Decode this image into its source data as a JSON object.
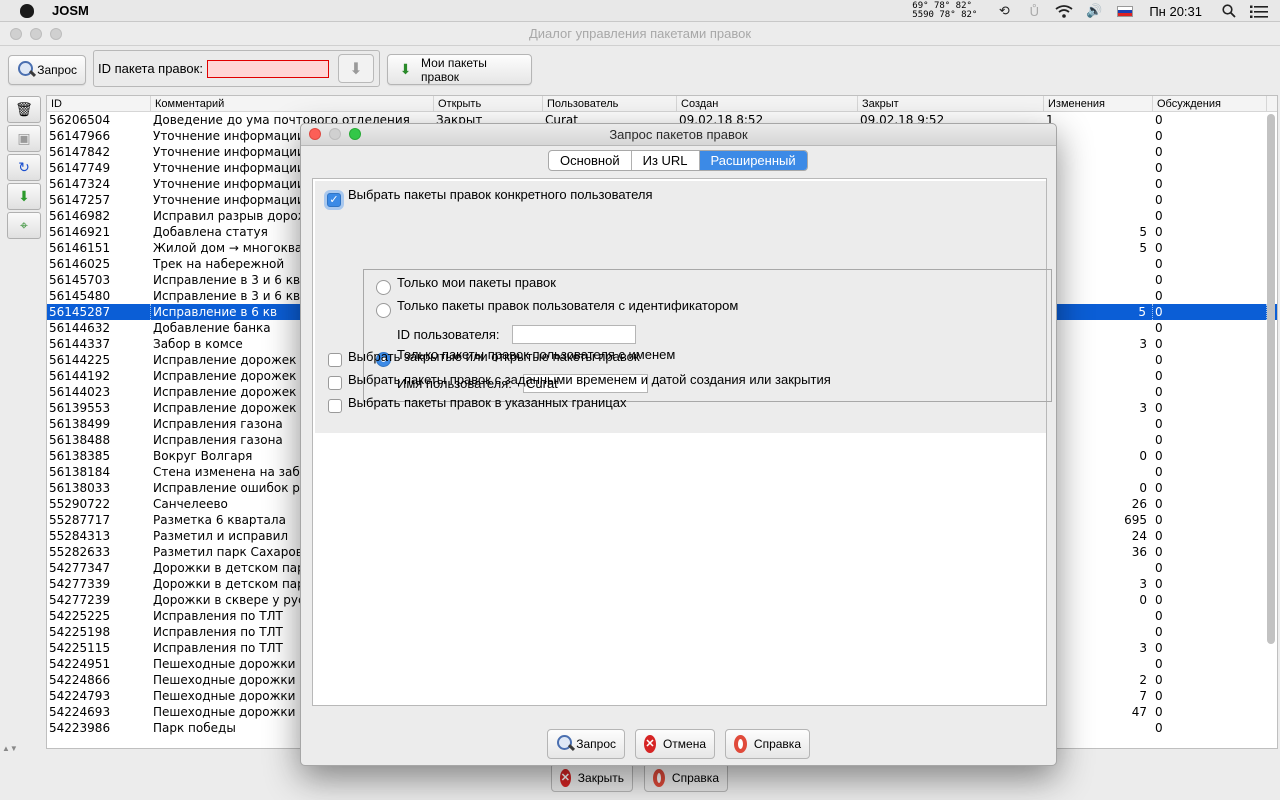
{
  "menubar": {
    "app_name": "JOSM",
    "temps": [
      "69°  78° 82°",
      "5590  78° 82°"
    ],
    "clock": "Пн 20:31",
    "icons": [
      "time-machine-icon",
      "bluetooth-icon",
      "wifi-icon",
      "volume-icon",
      "flag-ru-icon",
      "spotlight-icon",
      "notification-center-icon"
    ]
  },
  "window": {
    "title": "Диалог управления пакетами правок"
  },
  "toolbar": {
    "query_label": "Запрос",
    "changeset_id_label": "ID пакета правок:",
    "changeset_id_value": "",
    "my_changesets_label": "Мои пакеты правок"
  },
  "table": {
    "columns": [
      "ID",
      "Комментарий",
      "Открыть",
      "Пользователь",
      "Создан",
      "Закрыт",
      "Изменения",
      "Обсуждения"
    ],
    "first_row": {
      "id": "56206504",
      "comment": "Доведение до ума почтового отделения",
      "open": "Закрыт",
      "user": "Curat",
      "created": "09.02.18 8:52",
      "closed": "09.02.18 9:52",
      "changes": "1",
      "discussions": "0"
    },
    "rows": [
      {
        "id": "56147966",
        "comment": "Уточнение информации",
        "changes": "",
        "discussions": "0"
      },
      {
        "id": "56147842",
        "comment": "Уточнение информации",
        "changes": "",
        "discussions": "0"
      },
      {
        "id": "56147749",
        "comment": "Уточнение информации",
        "changes": "",
        "discussions": "0"
      },
      {
        "id": "56147324",
        "comment": "Уточнение информации",
        "changes": "",
        "discussions": "0"
      },
      {
        "id": "56147257",
        "comment": "Уточнение информации",
        "changes": "",
        "discussions": "0"
      },
      {
        "id": "56146982",
        "comment": "Исправил разрыв дорож",
        "changes": "",
        "discussions": "0"
      },
      {
        "id": "56146921",
        "comment": "Добавлена статуя",
        "changes": "5",
        "discussions": "0"
      },
      {
        "id": "56146151",
        "comment": "Жилой дом → многоквар",
        "changes": "5",
        "discussions": "0"
      },
      {
        "id": "56146025",
        "comment": "Трек на набережной",
        "changes": "",
        "discussions": "0"
      },
      {
        "id": "56145703",
        "comment": "Исправление в 3 и 6 кв",
        "changes": "",
        "discussions": "0"
      },
      {
        "id": "56145480",
        "comment": "Исправление в 3 и 6 кв",
        "changes": "",
        "discussions": "0"
      },
      {
        "id": "56145287",
        "comment": "Исправление в 6 кв",
        "changes": "5",
        "discussions": "0",
        "selected": true
      },
      {
        "id": "56144632",
        "comment": "Добавление банка",
        "changes": "",
        "discussions": "0"
      },
      {
        "id": "56144337",
        "comment": "Забор в комсе",
        "changes": "3",
        "discussions": "0"
      },
      {
        "id": "56144225",
        "comment": "Исправление дорожек у",
        "changes": "",
        "discussions": "0"
      },
      {
        "id": "56144192",
        "comment": "Исправление дорожек у",
        "changes": "",
        "discussions": "0"
      },
      {
        "id": "56144023",
        "comment": "Исправление дорожек в",
        "changes": "",
        "discussions": "0"
      },
      {
        "id": "56139553",
        "comment": "Исправление дорожек в",
        "changes": "3",
        "discussions": "0"
      },
      {
        "id": "56138499",
        "comment": "Исправления газона",
        "changes": "",
        "discussions": "0"
      },
      {
        "id": "56138488",
        "comment": "Исправления газона",
        "changes": "",
        "discussions": "0"
      },
      {
        "id": "56138385",
        "comment": "Вокруг Волгаря",
        "changes": "0",
        "discussions": "0"
      },
      {
        "id": "56138184",
        "comment": "Стена изменена на забо",
        "changes": "",
        "discussions": "0"
      },
      {
        "id": "56138033",
        "comment": "Исправление ошибок ра",
        "changes": "0",
        "discussions": "0"
      },
      {
        "id": "55290722",
        "comment": "Санчелеево",
        "changes": "26",
        "discussions": "0"
      },
      {
        "id": "55287717",
        "comment": "Разметка 6 квартала",
        "changes": "695",
        "discussions": "0"
      },
      {
        "id": "55284313",
        "comment": "Разметил и исправил",
        "changes": "24",
        "discussions": "0"
      },
      {
        "id": "55282633",
        "comment": "Разметил парк Сахарова",
        "changes": "36",
        "discussions": "0"
      },
      {
        "id": "54277347",
        "comment": "Дорожки в детском пар",
        "changes": "",
        "discussions": "0"
      },
      {
        "id": "54277339",
        "comment": "Дорожки в детском пар",
        "changes": "3",
        "discussions": "0"
      },
      {
        "id": "54277239",
        "comment": "Дорожки в сквере у рус",
        "changes": "0",
        "discussions": "0"
      },
      {
        "id": "54225225",
        "comment": "Исправления по ТЛТ",
        "changes": "",
        "discussions": "0"
      },
      {
        "id": "54225198",
        "comment": "Исправления по ТЛТ",
        "changes": "",
        "discussions": "0"
      },
      {
        "id": "54225115",
        "comment": "Исправления по ТЛТ",
        "changes": "3",
        "discussions": "0"
      },
      {
        "id": "54224951",
        "comment": "Пешеходные дорожки и",
        "changes": "",
        "discussions": "0"
      },
      {
        "id": "54224866",
        "comment": "Пешеходные дорожки и",
        "changes": "2",
        "discussions": "0"
      },
      {
        "id": "54224793",
        "comment": "Пешеходные дорожки и",
        "changes": "7",
        "discussions": "0"
      },
      {
        "id": "54224693",
        "comment": "Пешеходные дорожки и",
        "changes": "47",
        "discussions": "0"
      },
      {
        "id": "54223986",
        "comment": "Парк победы",
        "changes": "",
        "discussions": "0"
      }
    ]
  },
  "main_buttons": {
    "close_label": "Закрыть",
    "help_label": "Справка"
  },
  "dialog": {
    "title": "Запрос пакетов правок",
    "tabs": [
      {
        "label": "Основной",
        "active": false
      },
      {
        "label": "Из URL",
        "active": false
      },
      {
        "label": "Расширенный",
        "active": true
      }
    ],
    "user_filter": {
      "label": "Выбрать пакеты правок конкретного пользователя",
      "checked": true,
      "only_mine_label": "Только мои пакеты правок",
      "by_id_label": "Только пакеты правок пользователя с идентификатором",
      "user_id_label": "ID пользователя:",
      "user_id_value": "",
      "by_name_label": "Только пакеты правок пользователя с именем",
      "user_name_label": "Имя пользователя:",
      "user_name_value": "Curat"
    },
    "open_closed_label": "Выбрать закрытые или открытые пакеты правок",
    "time_label": "Выбрать пакеты правок с заданными временем и датой создания или закрытия",
    "bounds_label": "Выбрать пакеты правок в указанных границах",
    "query_label": "Запрос",
    "cancel_label": "Отмена",
    "help_label": "Справка"
  },
  "colors": {
    "selection": "#0b5ed6",
    "accent": "#3c8ae6",
    "error_field": "#ffd6d6"
  }
}
